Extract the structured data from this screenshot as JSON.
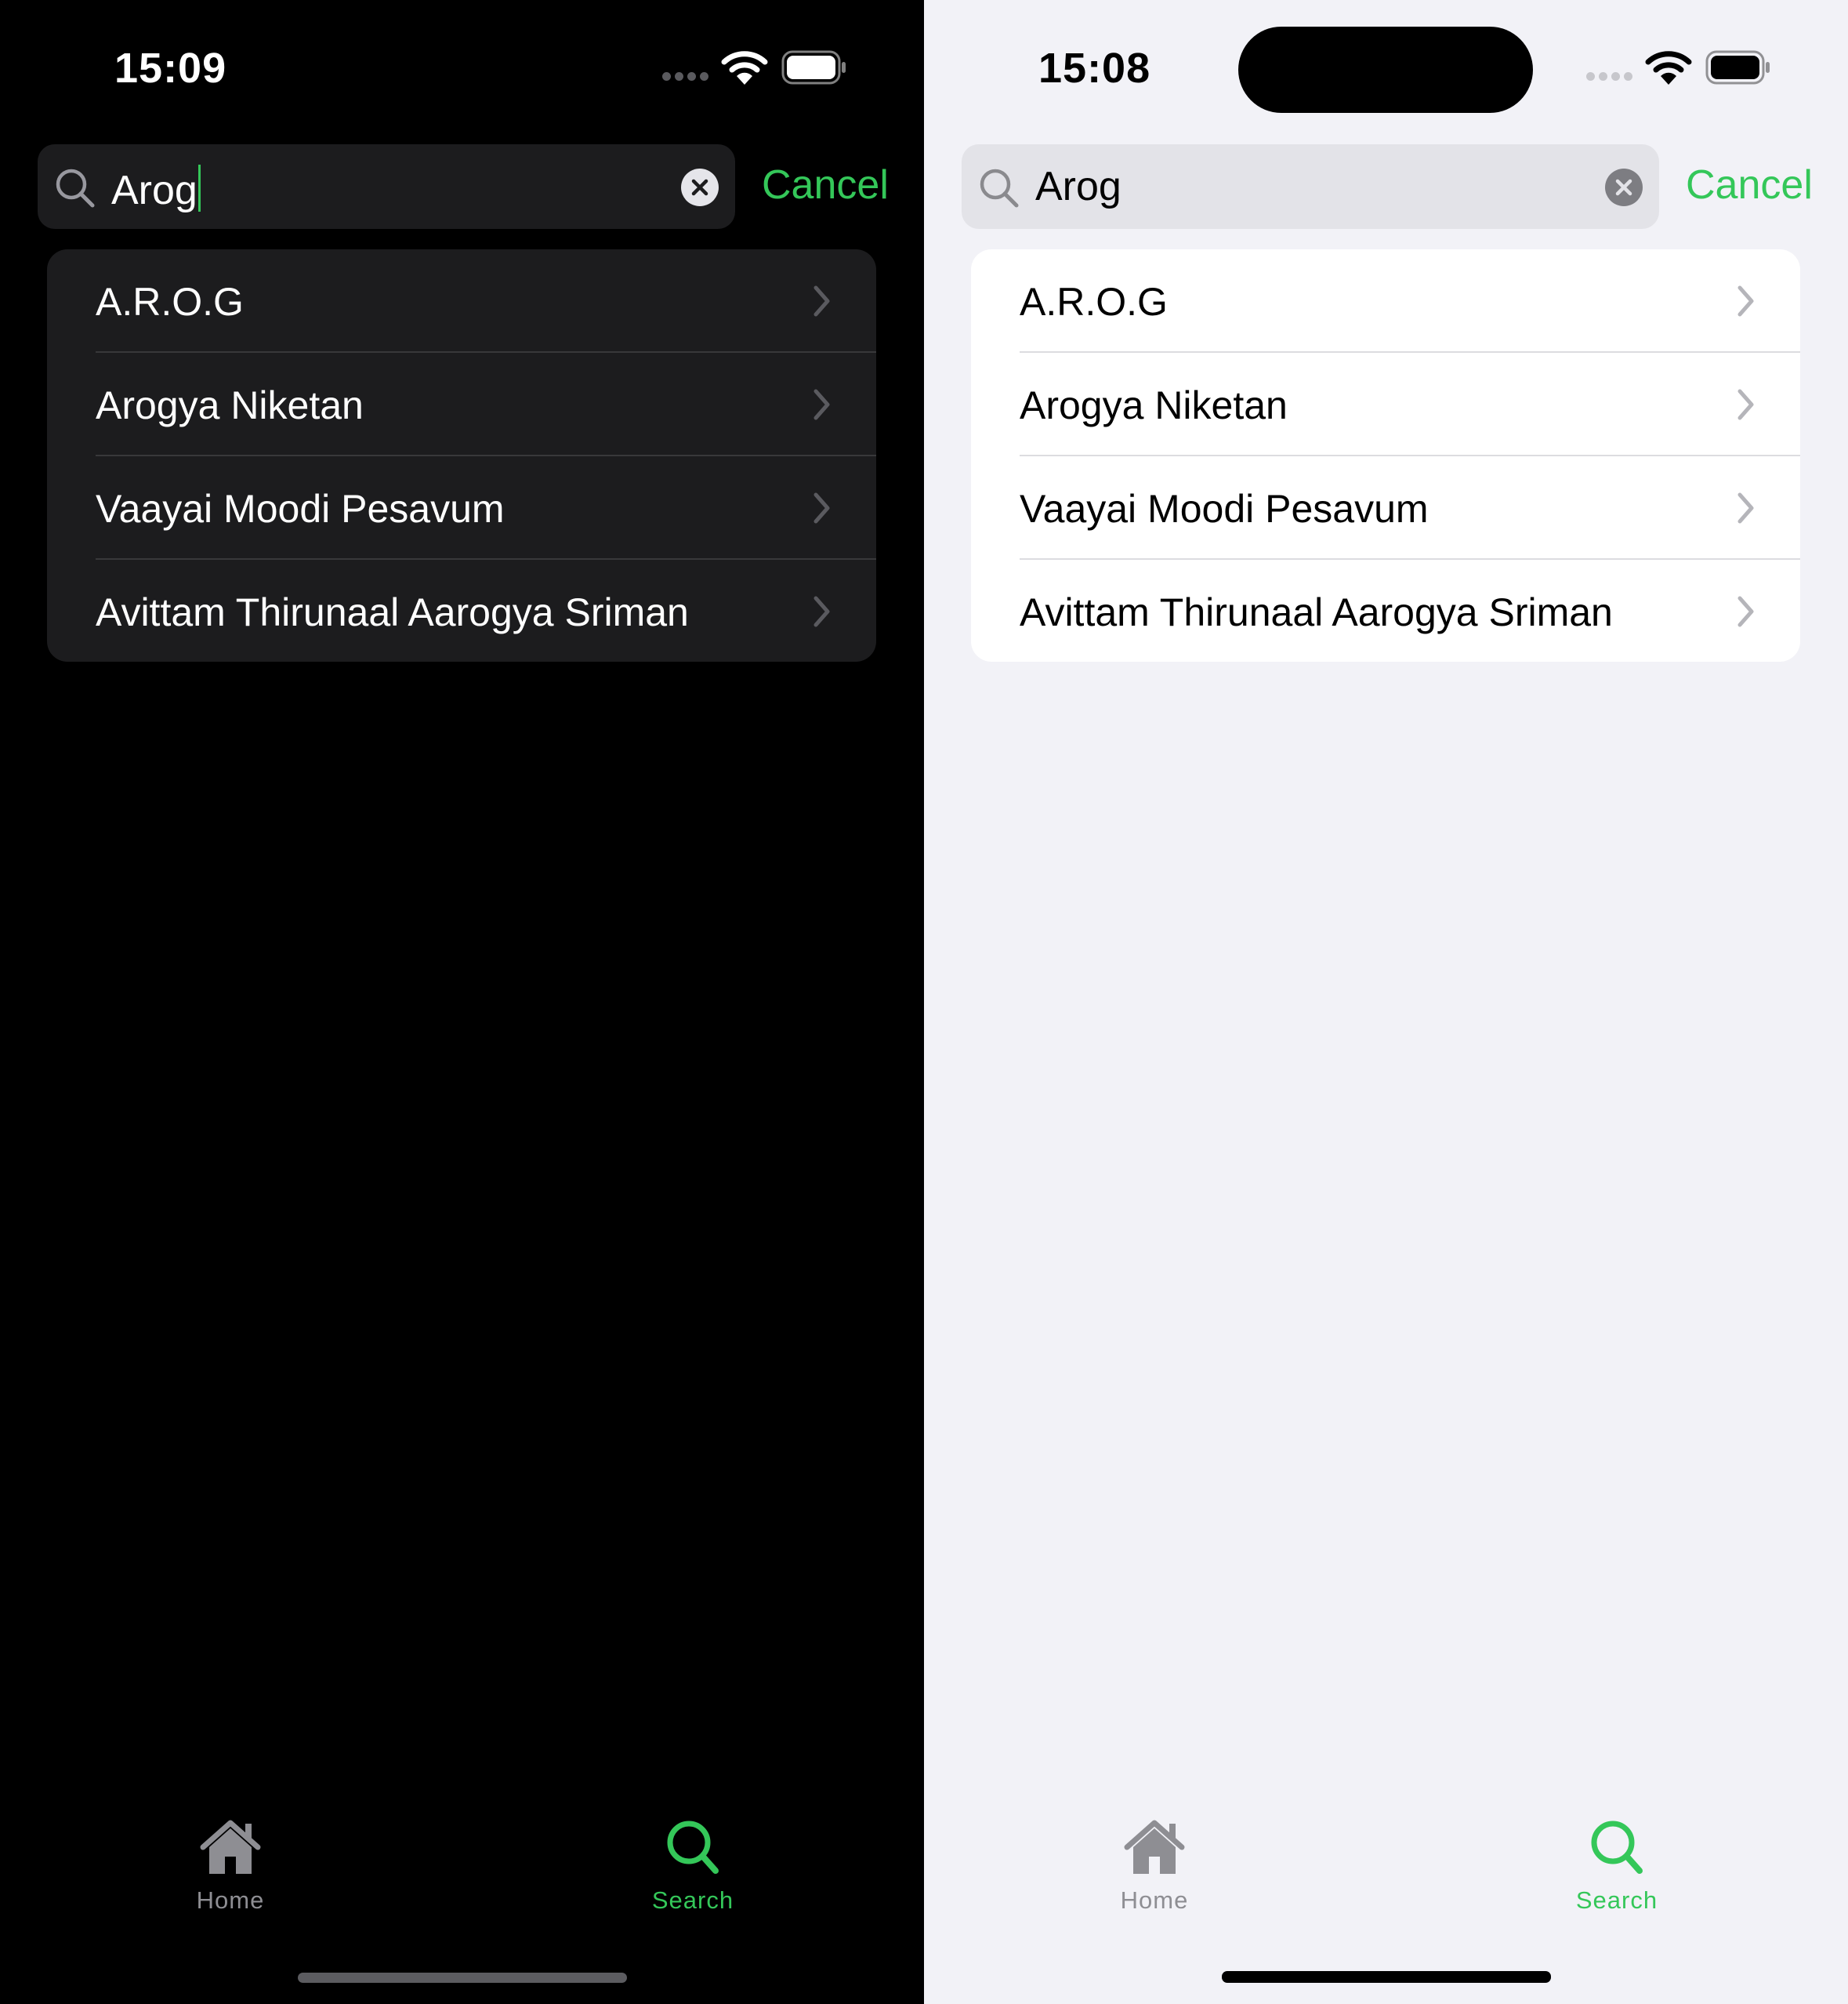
{
  "colors": {
    "accent": "#34c759",
    "dark_background": "#000000",
    "dark_surface": "#1c1c1e",
    "light_background": "#f2f2f7",
    "light_surface": "#ffffff",
    "inactive_tab": "#8e8e93"
  },
  "icons": {
    "search": "magnifying-glass",
    "clear": "xmark-circle-fill",
    "chevron": "chevron-right",
    "home": "house-fill",
    "wifi": "wifi",
    "battery": "battery-full"
  },
  "dark": {
    "status": {
      "time": "15:09"
    },
    "search": {
      "value": "Arog",
      "cancel_label": "Cancel"
    },
    "results": [
      {
        "label": "A.R.O.G"
      },
      {
        "label": "Arogya Niketan"
      },
      {
        "label": "Vaayai Moodi Pesavum"
      },
      {
        "label": "Avittam Thirunaal Aarogya Sriman"
      }
    ],
    "tabbar": {
      "home_label": "Home",
      "search_label": "Search",
      "selected": "Search"
    }
  },
  "light": {
    "status": {
      "time": "15:08"
    },
    "search": {
      "value": "Arog",
      "cancel_label": "Cancel"
    },
    "results": [
      {
        "label": "A.R.O.G"
      },
      {
        "label": "Arogya Niketan"
      },
      {
        "label": "Vaayai Moodi Pesavum"
      },
      {
        "label": "Avittam Thirunaal Aarogya Sriman"
      }
    ],
    "tabbar": {
      "home_label": "Home",
      "search_label": "Search",
      "selected": "Search"
    }
  }
}
